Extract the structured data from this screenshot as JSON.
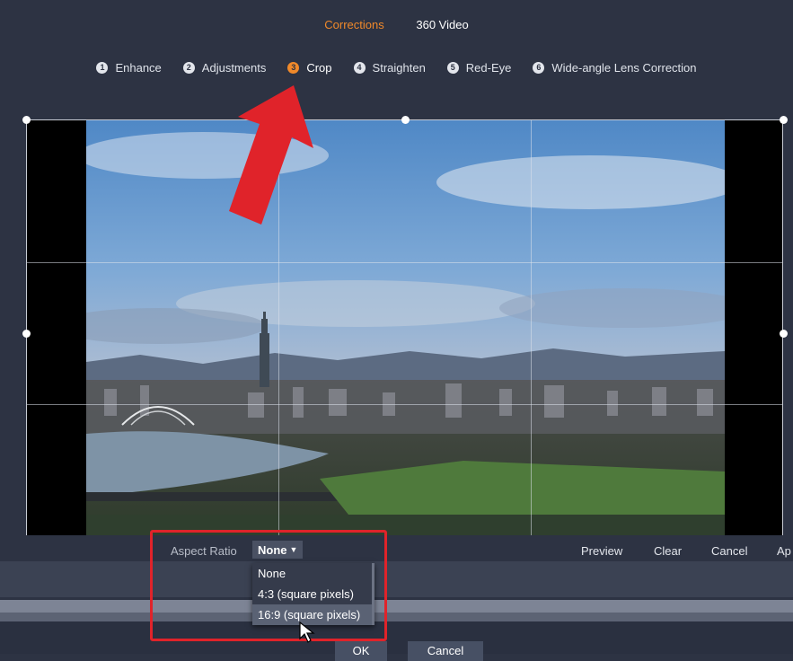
{
  "top_tabs": [
    {
      "label": "Corrections",
      "active": true
    },
    {
      "label": "360 Video",
      "active": false
    }
  ],
  "steps": [
    {
      "num": "1",
      "label": "Enhance"
    },
    {
      "num": "2",
      "label": "Adjustments"
    },
    {
      "num": "3",
      "label": "Crop",
      "active": true
    },
    {
      "num": "4",
      "label": "Straighten"
    },
    {
      "num": "5",
      "label": "Red-Eye"
    },
    {
      "num": "6",
      "label": "Wide-angle Lens Correction"
    }
  ],
  "crop_toolbar": {
    "aspect_label": "Aspect Ratio",
    "aspect_value": "None",
    "preview": "Preview",
    "clear": "Clear",
    "cancel": "Cancel",
    "apply_partial": "Ap"
  },
  "aspect_dropdown": {
    "options": [
      "None",
      "4:3 (square pixels)",
      "16:9 (square pixels)"
    ],
    "hovered": "16:9 (square pixels)"
  },
  "dialog_buttons": {
    "ok": "OK",
    "cancel": "Cancel"
  },
  "colors": {
    "accent": "#f0892a",
    "annotation_red": "#e0232a",
    "background": "#2d3343"
  },
  "icons": [
    "red-arrow-annotation-icon",
    "mouse-pointer-icon",
    "dropdown-caret-icon"
  ]
}
